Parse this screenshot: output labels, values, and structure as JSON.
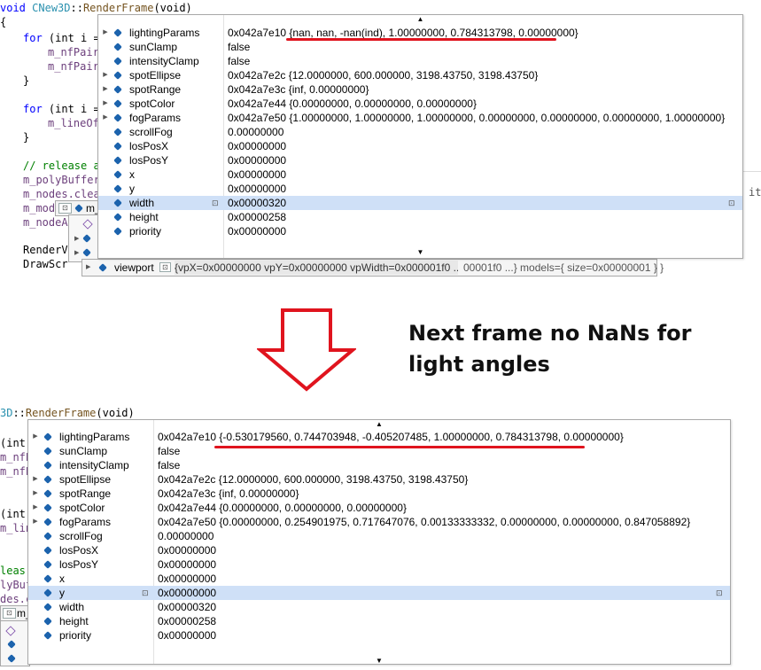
{
  "annotation": {
    "line1": "Next frame no NaNs for",
    "line2": "light angles"
  },
  "top": {
    "code": {
      "signature_kw": "void",
      "signature_class": "CNew3D",
      "signature_sep": "::",
      "signature_fn": "RenderFrame",
      "signature_rest": "(void)",
      "brace_open": "{",
      "for1": "for",
      "for1_rest": " (int i =",
      "pair1": "m_nfPair",
      "pair2": "m_nfPair",
      "close1": "}",
      "for2": "for",
      "for2_rest": " (int i =",
      "lineof": "m_lineOf",
      "close2": "}",
      "comment": "// release a",
      "polybuf": "m_polyBuffer",
      "nodes": "m_nodes.clea",
      "mod": "m_mod",
      "nodeA": "m_nodeA",
      "renderv": "RenderV",
      "drawscr": "DrawScr",
      "trail_it": "it",
      "stub_m": "m_"
    },
    "tooltip": {
      "rows": [
        {
          "name": "lightingParams",
          "value": "0x042a7e10 {nan, nan, -nan(ind), 1.00000000, 0.784313798, 0.00000000}",
          "expandable": true
        },
        {
          "name": "sunClamp",
          "value": "false",
          "expandable": false
        },
        {
          "name": "intensityClamp",
          "value": "false",
          "expandable": false
        },
        {
          "name": "spotEllipse",
          "value": "0x042a7e2c {12.0000000, 600.000000, 3198.43750, 3198.43750}",
          "expandable": true
        },
        {
          "name": "spotRange",
          "value": "0x042a7e3c {inf, 0.00000000}",
          "expandable": true
        },
        {
          "name": "spotColor",
          "value": "0x042a7e44 {0.00000000, 0.00000000, 0.00000000}",
          "expandable": true
        },
        {
          "name": "fogParams",
          "value": "0x042a7e50 {1.00000000, 1.00000000, 1.00000000, 0.00000000, 0.00000000, 0.00000000, 1.00000000}",
          "expandable": true
        },
        {
          "name": "scrollFog",
          "value": "0.00000000",
          "expandable": false
        },
        {
          "name": "losPosX",
          "value": "0x00000000",
          "expandable": false
        },
        {
          "name": "losPosY",
          "value": "0x00000000",
          "expandable": false
        },
        {
          "name": "x",
          "value": "0x00000000",
          "expandable": false
        },
        {
          "name": "y",
          "value": "0x00000000",
          "expandable": false
        },
        {
          "name": "width",
          "value": "0x00000320",
          "expandable": false,
          "selected": true
        },
        {
          "name": "height",
          "value": "0x00000258",
          "expandable": false
        },
        {
          "name": "priority",
          "value": "0x00000000",
          "expandable": false
        }
      ]
    },
    "viewport": {
      "name": "viewport",
      "value": "{vpX=0x00000000 vpY=0x00000000 vpWidth=0x000001f0 ...}",
      "trail": "00001f0 ...} models={ size=0x00000001 } }"
    }
  },
  "bottom": {
    "code": {
      "sig_class": "3D",
      "sig_sep": "::",
      "sig_fn": "RenderFrame",
      "sig_rest": "(void)",
      "l1": "(int",
      "l2": "m_nfP",
      "l3": "m_nfP",
      "l4": "(int",
      "l5": "m_lin",
      "l6": "leas",
      "l7": "lyBuf",
      "l8": "des.c",
      "l9": "m_"
    },
    "tooltip": {
      "rows": [
        {
          "name": "lightingParams",
          "value": "0x042a7e10 {-0.530179560, 0.744703948, -0.405207485, 1.00000000, 0.784313798, 0.00000000}",
          "expandable": true
        },
        {
          "name": "sunClamp",
          "value": "false",
          "expandable": false
        },
        {
          "name": "intensityClamp",
          "value": "false",
          "expandable": false
        },
        {
          "name": "spotEllipse",
          "value": "0x042a7e2c {12.0000000, 600.000000, 3198.43750, 3198.43750}",
          "expandable": true
        },
        {
          "name": "spotRange",
          "value": "0x042a7e3c {inf, 0.00000000}",
          "expandable": true
        },
        {
          "name": "spotColor",
          "value": "0x042a7e44 {0.00000000, 0.00000000, 0.00000000}",
          "expandable": true
        },
        {
          "name": "fogParams",
          "value": "0x042a7e50 {0.00000000, 0.254901975, 0.717647076, 0.00133333332, 0.00000000, 0.00000000, 0.847058892}",
          "expandable": true
        },
        {
          "name": "scrollFog",
          "value": "0.00000000",
          "expandable": false
        },
        {
          "name": "losPosX",
          "value": "0x00000000",
          "expandable": false
        },
        {
          "name": "losPosY",
          "value": "0x00000000",
          "expandable": false
        },
        {
          "name": "x",
          "value": "0x00000000",
          "expandable": false
        },
        {
          "name": "y",
          "value": "0x00000000",
          "expandable": false,
          "selected": true
        },
        {
          "name": "width",
          "value": "0x00000320",
          "expandable": false
        },
        {
          "name": "height",
          "value": "0x00000258",
          "expandable": false
        },
        {
          "name": "priority",
          "value": "0x00000000",
          "expandable": false
        }
      ]
    }
  },
  "icons": {
    "member": "field-icon",
    "expand": "expand-triangle-icon",
    "pin": "pin-icon",
    "arrow": "down-arrow-icon"
  },
  "colors": {
    "highlight": "#e0141e",
    "selection": "#cfe0f7",
    "arrow": "#e0141e"
  }
}
